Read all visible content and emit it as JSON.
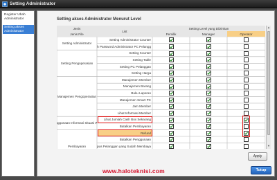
{
  "window": {
    "title": "Setting Administrator"
  },
  "sidebar": {
    "items": [
      {
        "label": "Register Ubah Administrator",
        "active": false
      },
      {
        "label": "Setting akses Administrator",
        "active": true
      }
    ]
  },
  "panel": {
    "title": "Setting akses Administrator Menurut Level",
    "header": {
      "jenis": "Jenis",
      "jenis_file": "Jenis File",
      "list": "List",
      "setting_level": "Setting Level yang Diizinkan",
      "levels": [
        "Pemilik",
        "Manager",
        "Operator"
      ]
    },
    "groups": [
      {
        "label": "Setting Administrator",
        "rows": 2
      },
      {
        "label": "Setting Pengoperasian",
        "rows": 4
      },
      {
        "label": "Manajemen Pengoperasian",
        "rows": 6
      },
      {
        "label": "anggunaan Informasi Situasi Wa",
        "rows": 2
      },
      {
        "label": "Pembayaran",
        "rows": 5
      }
    ],
    "rows": [
      {
        "item": "Setting Administrator Counter",
        "checks": [
          true,
          true,
          false
        ]
      },
      {
        "item": "ah Password Administrator PC Pelangg",
        "checks": [
          true,
          true,
          false
        ]
      },
      {
        "item": "Setting Kounter",
        "checks": [
          true,
          true,
          false
        ]
      },
      {
        "item": "Setting Table",
        "checks": [
          true,
          true,
          false
        ]
      },
      {
        "item": "Setting PC Pelanggan",
        "checks": [
          true,
          true,
          false
        ]
      },
      {
        "item": "Setting Harga",
        "checks": [
          true,
          true,
          false
        ]
      },
      {
        "item": "Manajemen Member",
        "checks": [
          true,
          true,
          false
        ]
      },
      {
        "item": "Manajemen Barang",
        "checks": [
          true,
          true,
          false
        ]
      },
      {
        "item": "Buku Laporan",
        "checks": [
          true,
          true,
          false
        ]
      },
      {
        "item": "Manajemen Smart PC",
        "checks": [
          true,
          true,
          false
        ]
      },
      {
        "item": "Jam Member",
        "checks": [
          true,
          true,
          false
        ]
      },
      {
        "item": "Lihat Informasi Member",
        "checks": [
          true,
          true,
          false
        ]
      },
      {
        "item": "Lihat Jumlah Cash Box Sekarang",
        "checks": [
          true,
          true,
          true
        ]
      },
      {
        "item": "Batalkan Pembayaran",
        "checks": [
          true,
          true,
          false
        ]
      },
      {
        "item": "Refund",
        "checks": [
          true,
          true,
          true
        ]
      },
      {
        "item": "Batalkan Penggunaan",
        "checks": [
          true,
          true,
          false
        ]
      },
      {
        "item": "hapus Pelanggan yang Sudah Membaya",
        "checks": [
          true,
          true,
          false
        ]
      }
    ],
    "apply_label": "Apply"
  },
  "footer": {
    "watermark": "www.haloteknisi.com",
    "close_label": "Tutup"
  },
  "colors": {
    "titlebar": "#2a2a2a",
    "frame": "#4a4a4a",
    "sidebar_active": "#3a7fd5",
    "operator_header": "#f8cf86",
    "highlight": "#e21a1a",
    "checkmark": "#1e8c1e",
    "watermark": "#d4102a",
    "close_button": "#2f78d0"
  }
}
